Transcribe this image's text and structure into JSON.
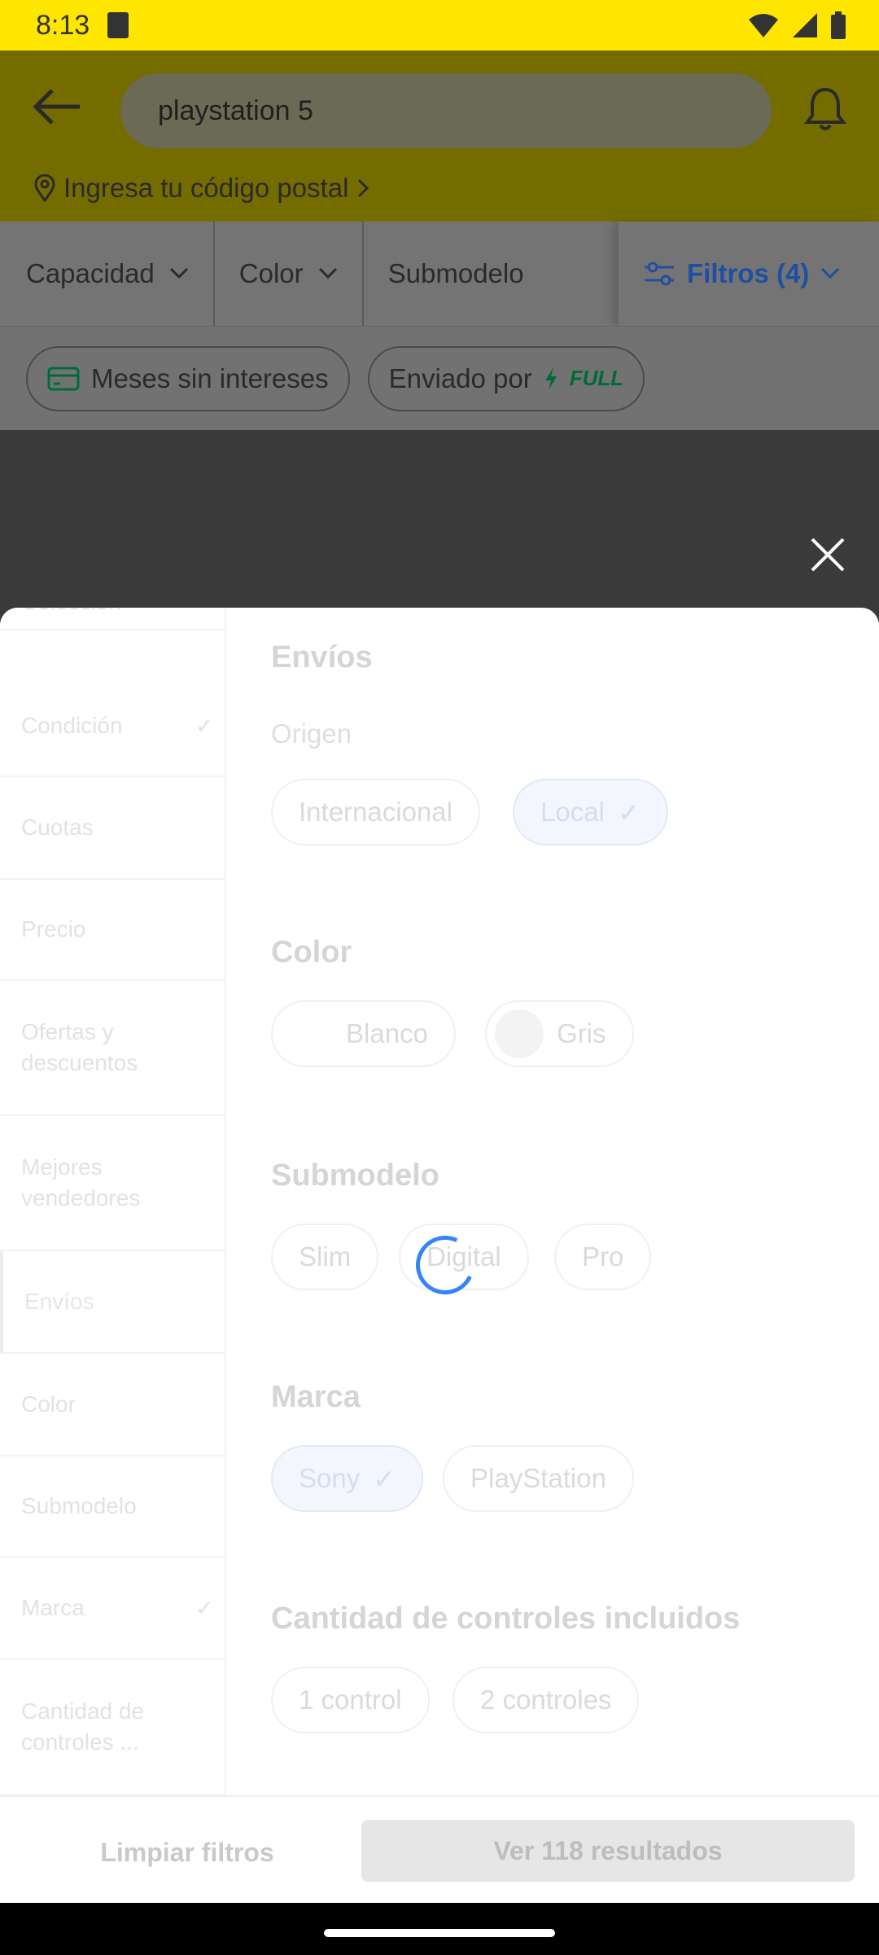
{
  "status_bar": {
    "time": "8:13"
  },
  "header": {
    "search_value": "playstation 5",
    "zip_prompt": "Ingresa tu código postal"
  },
  "filter_bar": {
    "items": [
      "Capacidad",
      "Color",
      "Submodelo"
    ],
    "filters_label": "Filtros (4)"
  },
  "quick_chips": {
    "installments": "Meses sin intereses",
    "shipped_by": "Enviado por",
    "full_badge": "FULL"
  },
  "side_menu": [
    {
      "label": "Colección"
    },
    {
      "label": "Condición",
      "checked": true
    },
    {
      "label": "Cuotas"
    },
    {
      "label": "Precio"
    },
    {
      "label": "Ofertas y descuentos"
    },
    {
      "label": "Mejores vendedores"
    },
    {
      "label": "Envíos",
      "active": true
    },
    {
      "label": "Color"
    },
    {
      "label": "Submodelo"
    },
    {
      "label": "Marca",
      "checked": true
    },
    {
      "label": "Cantidad de controles ..."
    }
  ],
  "sections": {
    "shipping": {
      "title": "Envíos",
      "subtitle": "Origen",
      "options": [
        "Internacional",
        "Local"
      ],
      "selected": "Local"
    },
    "color": {
      "title": "Color",
      "options": [
        "Blanco",
        "Gris"
      ]
    },
    "submodel": {
      "title": "Submodelo",
      "options": [
        "Slim",
        "Digital",
        "Pro"
      ]
    },
    "brand": {
      "title": "Marca",
      "options": [
        "Sony",
        "PlayStation"
      ],
      "selected": "Sony"
    },
    "controllers": {
      "title": "Cantidad de controles incluidos",
      "options": [
        "1 control",
        "2 controles"
      ]
    }
  },
  "footer": {
    "clear_label": "Limpiar filtros",
    "results_label": "Ver 118 resultados"
  },
  "colors": {
    "brand_yellow": "#ffe600",
    "accent_blue": "#3483fa"
  }
}
